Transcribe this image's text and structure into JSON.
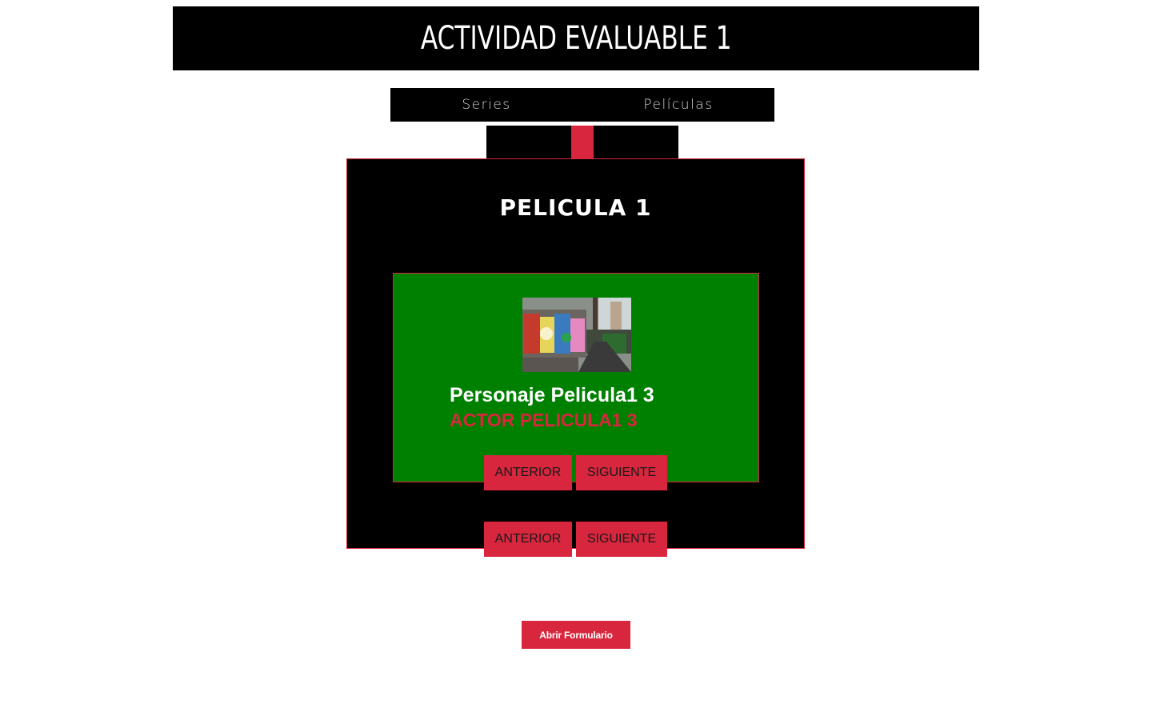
{
  "header": {
    "title": "ACTIVIDAD EVALUABLE 1"
  },
  "nav": {
    "items": [
      {
        "label": "Series"
      },
      {
        "label": "Películas"
      }
    ]
  },
  "movie": {
    "title": "PELICULA 1",
    "character": {
      "image_icon": "graffiti-street-photo",
      "name": "Personaje Pelicula1 3",
      "actor": "ACTOR PELICULA1 3",
      "prev_label": "ANTERIOR",
      "next_label": "SIGUIENTE"
    },
    "prev_label": "ANTERIOR",
    "next_label": "SIGUIENTE"
  },
  "form": {
    "open_label": "Abrir Formulario"
  },
  "colors": {
    "accent": "#d7263d",
    "card": "#008000",
    "panel": "#000000"
  }
}
